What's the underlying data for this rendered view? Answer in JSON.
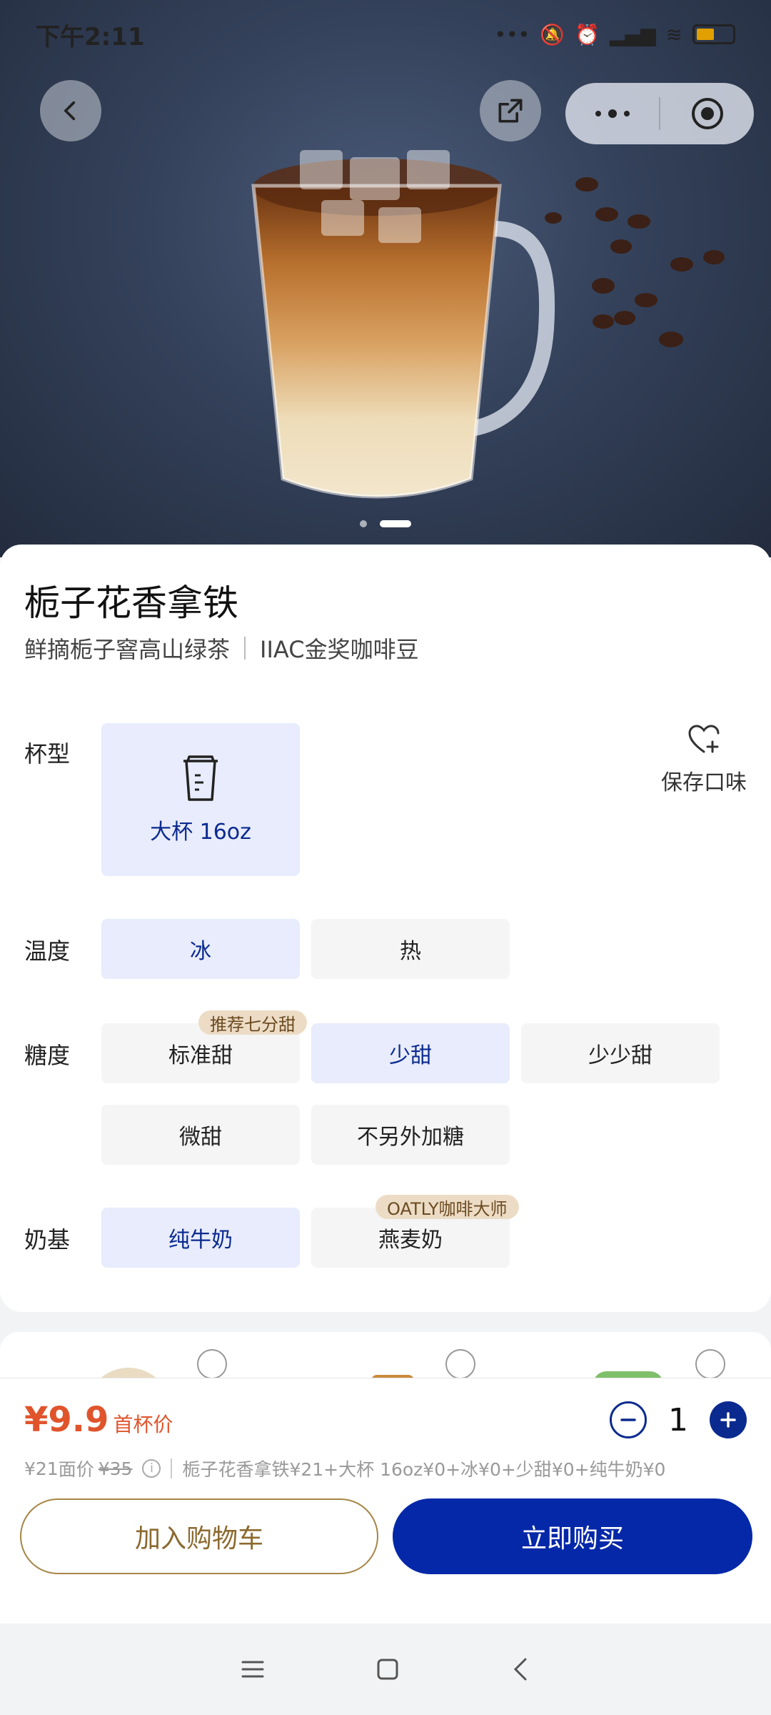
{
  "status_bar": {
    "time": "下午2:11",
    "icons": [
      "more-icon",
      "mute-icon",
      "alarm-icon",
      "signal-icon",
      "wifi-icon",
      "battery-icon"
    ],
    "battery_level": 0.5
  },
  "product": {
    "name": "栀子花香拿铁",
    "tagline_left": "鲜摘栀子窨高山绿茶",
    "tagline_right": "IIAC金奖咖啡豆"
  },
  "carousel": {
    "count": 2,
    "active": 2
  },
  "options": {
    "cup": {
      "label": "杯型",
      "choices": [
        "大杯 16oz"
      ],
      "selected": "大杯 16oz"
    },
    "temperature": {
      "label": "温度",
      "choices": [
        "冰",
        "热"
      ],
      "selected": "冰"
    },
    "sweetness": {
      "label": "糖度",
      "choices": [
        "标准甜",
        "少甜",
        "少少甜",
        "微甜",
        "不另外加糖"
      ],
      "selected": "少甜",
      "tag": "推荐七分甜"
    },
    "milk": {
      "label": "奶基",
      "choices": [
        "纯牛奶",
        "燕麦奶"
      ],
      "selected": "纯牛奶",
      "tag": "OATLY咖啡大师"
    }
  },
  "save_flavor": "保存口味",
  "price": {
    "current": "¥9.9",
    "current_note": "首杯价",
    "face_value": "¥21",
    "face_label": "面价",
    "original": "¥35",
    "breakdown": "栀子花香拿铁¥21+大杯 16oz¥0+冰¥0+少甜¥0+纯牛奶¥0"
  },
  "quantity": "1",
  "buttons": {
    "add_to_cart": "加入购物车",
    "buy_now": "立即购买"
  },
  "colors": {
    "accent_blue": "#0428a8",
    "price_red": "#e0542c",
    "selected_bg": "#e8ecfc",
    "tag_bg": "#eddcc5",
    "cart_gold": "#a68546"
  }
}
